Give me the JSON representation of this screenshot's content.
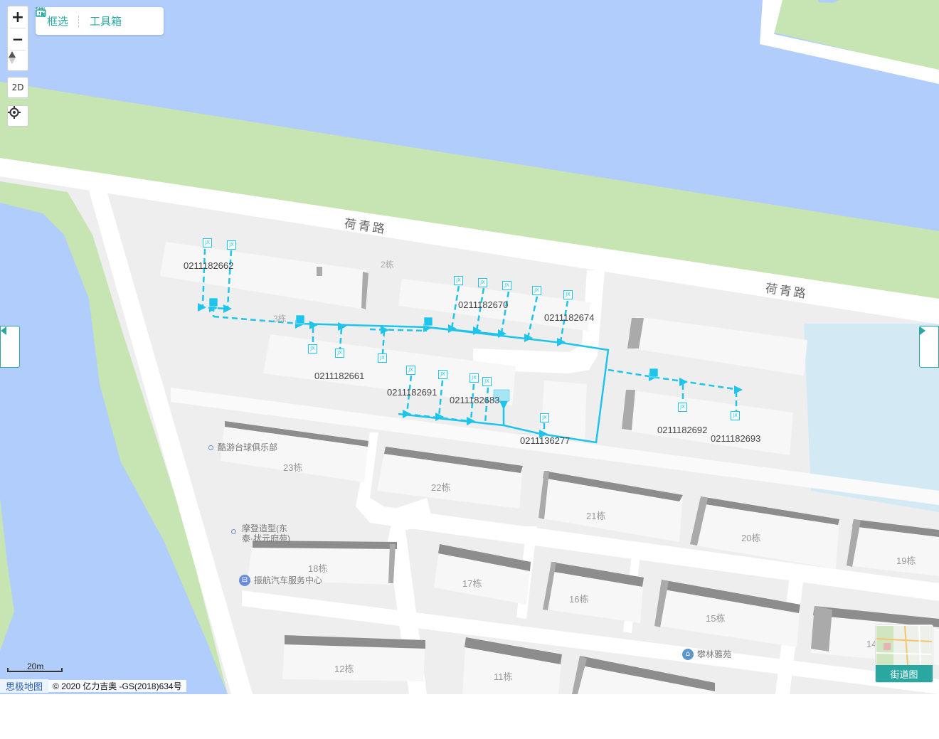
{
  "toolbar": {
    "zoom_in": "+",
    "zoom_out": "−",
    "view_2d": "2D",
    "select_label": "框选",
    "toolbox_label": "工具箱"
  },
  "colors": {
    "water": "#b1cdfb",
    "green": "#c7e4b3",
    "pipe": "#1ec4ea",
    "accent": "#2aa7a0",
    "pond": "#d3e9f4"
  },
  "roads": [
    {
      "name": "荷青路"
    },
    {
      "name": "荷青路"
    }
  ],
  "cables": [
    {
      "id": "0211182662"
    },
    {
      "id": "0211182661"
    },
    {
      "id": "0211182670"
    },
    {
      "id": "0211182674"
    },
    {
      "id": "0211182691"
    },
    {
      "id": "0211182683"
    },
    {
      "id": "0211136277"
    },
    {
      "id": "0211182692"
    },
    {
      "id": "0211182693"
    }
  ],
  "buildings": [
    {
      "label": "2栋"
    },
    {
      "label": "3栋"
    },
    {
      "label": "23栋"
    },
    {
      "label": "22栋"
    },
    {
      "label": "21栋"
    },
    {
      "label": "20栋"
    },
    {
      "label": "19栋"
    },
    {
      "label": "18栋"
    },
    {
      "label": "17栋"
    },
    {
      "label": "16栋"
    },
    {
      "label": "15栋"
    },
    {
      "label": "14"
    },
    {
      "label": "12栋"
    },
    {
      "label": "11栋"
    }
  ],
  "pois": [
    {
      "name": "酷游台球俱乐部",
      "icon": "dot-icon"
    },
    {
      "name": "摩登造型(东",
      "name2": "泰·状元府苑)",
      "icon": "dot-icon"
    },
    {
      "name": "振航汽车服务中心",
      "icon": "car-service-icon"
    },
    {
      "name": "攀林雅苑",
      "icon": "residence-icon"
    }
  ],
  "node_label": "JX",
  "scale_label": "20m",
  "attribution": {
    "logo": "思极地图",
    "copyright": "© 2020 亿力吉奥 -GS(2018)634号"
  },
  "street_view_label": "街道图"
}
